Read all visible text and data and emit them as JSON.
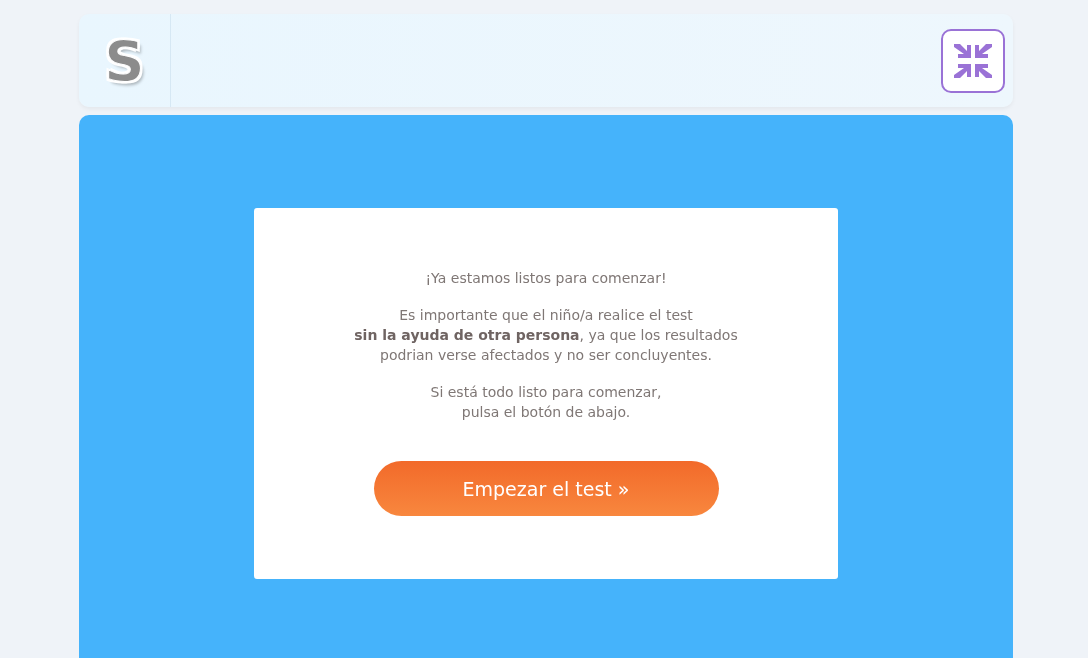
{
  "header": {
    "logo": "S"
  },
  "card": {
    "paragraphs": [
      "¡Ya estamos listos para comenzar!",
      "Es importante que el niño/a realice el test\n**sin la ayuda de otra persona**, ya que los resultados\npodrian verse afectados y no ser concluyentes.",
      "Si está todo listo para comenzar,\npulsa el botón de abajo."
    ],
    "button": "Empezar el test »"
  }
}
